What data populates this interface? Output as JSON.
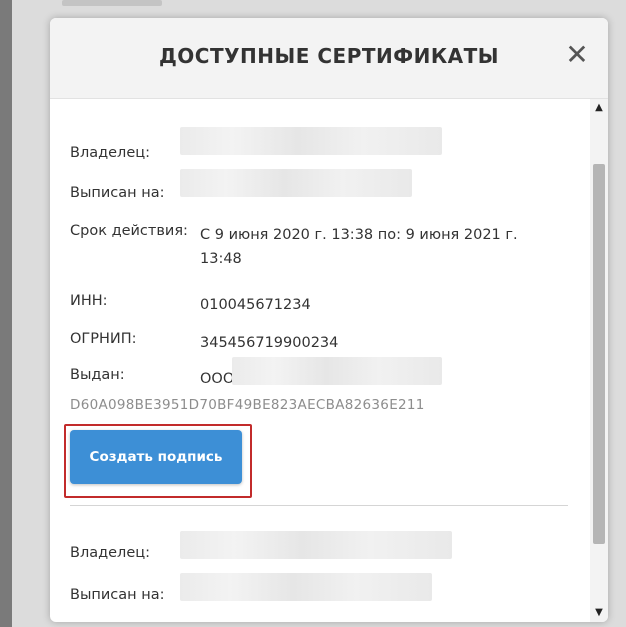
{
  "modal": {
    "title": "ДОСТУПНЫЕ СЕРТИФИКАТЫ",
    "close_icon": "close-icon",
    "close_glyph": "✕"
  },
  "certificate_1": {
    "owner_label": "Владелец:",
    "issued_to_label": "Выписан на:",
    "validity_label": "Срок действия:",
    "validity_value": "С 9 июня 2020 г. 13:38 по: 9 июня 2021 г. 13:48",
    "inn_label": "ИНН:",
    "inn_value": "010045671234",
    "ogrnip_label": "ОГРНИП:",
    "ogrnip_value": "345456719900234",
    "issuer_label": "Выдан:",
    "issuer_value": "ООО",
    "thumbprint": "D60A098BE3951D70BF49BE823AECBA82636E211",
    "create_signature_label": "Создать подпись"
  },
  "certificate_2": {
    "owner_label": "Владелец:",
    "issued_to_label": "Выписан на:"
  },
  "scrollbar": {
    "up_glyph": "▲",
    "down_glyph": "▼"
  },
  "colors": {
    "accent": "#3d8fd6",
    "highlight_border": "#c22b2b",
    "thumbprint_text": "#8d8d8d"
  }
}
